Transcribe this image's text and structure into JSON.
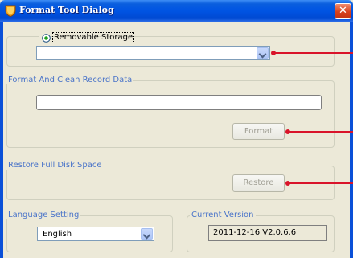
{
  "window": {
    "title": "Format Tool Dialog",
    "close_glyph": "✕"
  },
  "removable": {
    "radio_label": "Removable Storage",
    "selected": true,
    "drive_value": ""
  },
  "format_section": {
    "legend": "Format And Clean Record Data",
    "input_value": "",
    "button_label": "Format"
  },
  "restore_section": {
    "legend": "Restore Full Disk Space",
    "button_label": "Restore"
  },
  "language_section": {
    "legend": "Language Setting",
    "selected_value": "English"
  },
  "version_section": {
    "legend": "Current Version",
    "value": "2011-12-16 V2.0.6.6"
  },
  "colors": {
    "titlebar": "#0054e3",
    "dialog_bg": "#ece9d8",
    "legend_text": "#4a74c9",
    "annotation": "#d9142a"
  }
}
